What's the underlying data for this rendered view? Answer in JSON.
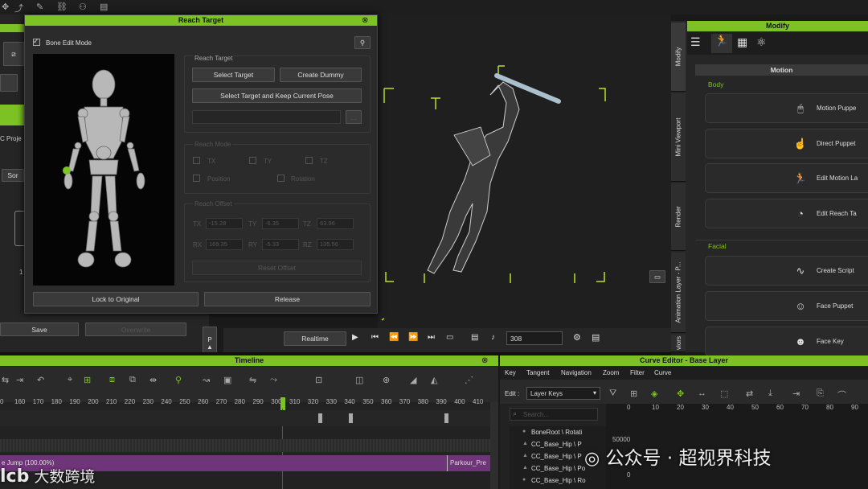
{
  "dialog": {
    "title": "Reach Target",
    "bone_edit": "Bone Edit Mode",
    "group_reach_target": "Reach Target",
    "select_target": "Select Target",
    "create_dummy": "Create  Dummy",
    "select_keep": "Select Target and Keep Current Pose",
    "reach_mode": "Reach Mode",
    "tx": "TX",
    "ty": "TY",
    "tz": "TZ",
    "position": "Position",
    "rotation": "Rotation",
    "reach_offset": "Reach Offset",
    "tx_val": "-15.28",
    "ty_val": "-6.35",
    "tz_val": "63.96",
    "rx_val": "169.35",
    "ry_val": "-5.33",
    "rz_val": "135.56",
    "rx": "RX",
    "ry": "RY",
    "rz": "RZ",
    "reset_offset": "Reset Offset",
    "lock_original": "Lock to Original",
    "release": "Release"
  },
  "left_strip": {
    "proj": "C Proje",
    "sor": "Sor",
    "num": "1",
    "save": "Save",
    "overwrite": "Overwrite"
  },
  "playback": {
    "realtime": "Realtime",
    "frame": "308"
  },
  "modify": {
    "title": "Modify",
    "vtabs": [
      "Modify",
      "Mini Viewport",
      "Render",
      "Animation Layer - P...",
      "viors"
    ],
    "section": "Motion",
    "body": "Body",
    "facial": "Facial",
    "body_items": [
      {
        "icon": "motion-puppet-icon",
        "label": "Motion Puppe"
      },
      {
        "icon": "direct-puppet-icon",
        "label": "Direct Puppet"
      },
      {
        "icon": "edit-motion-layer-icon",
        "label": "Edit Motion La"
      },
      {
        "icon": "edit-reach-target-icon",
        "label": "Edit Reach Ta"
      }
    ],
    "facial_items": [
      {
        "icon": "create-script-icon",
        "label": "Create Script"
      },
      {
        "icon": "face-puppet-icon",
        "label": "Face Puppet"
      },
      {
        "icon": "face-key-icon",
        "label": "Face Key"
      }
    ]
  },
  "timeline": {
    "title": "Timeline",
    "ticks": [
      "0",
      "160",
      "170",
      "180",
      "190",
      "200",
      "210",
      "220",
      "230",
      "240",
      "250",
      "260",
      "270",
      "280",
      "290",
      "300",
      "310",
      "320",
      "330",
      "340",
      "350",
      "360",
      "370",
      "380",
      "390",
      "400",
      "410"
    ],
    "clip1": "e Jump (100.00%)",
    "clip2": "Parkour_Pre"
  },
  "curve": {
    "title": "Curve Editor - Base Layer",
    "menu": [
      "Key",
      "Tangent",
      "Navigation",
      "Zoom",
      "Filter",
      "Curve"
    ],
    "edit": "Edit :",
    "layer": "Layer Keys",
    "search": "Search...",
    "tree": [
      "BoneRoot \\ Rotati",
      "CC_Base_Hip \\ P",
      "CC_Base_Hip \\ P",
      "CC_Base_Hip \\ Po",
      "CC_Base_Hip \\ Ro"
    ],
    "ticks": [
      "0",
      "10",
      "20",
      "30",
      "40",
      "50",
      "60",
      "70",
      "80",
      "90",
      "10"
    ],
    "y_top": "50000",
    "y_bot": "0"
  },
  "watermark": {
    "left": "大数跨境",
    "right": "公众号 · 超视界科技"
  }
}
